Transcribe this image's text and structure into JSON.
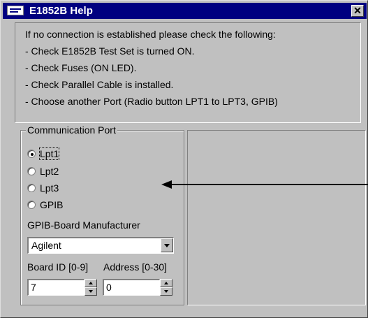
{
  "window": {
    "title": "E1852B Help",
    "icon": "app-window-icon",
    "close_glyph": "✕"
  },
  "info": {
    "lines": [
      "If no connection is established please check the following:",
      "- Check E1852B Test Set is turned ON.",
      "- Check Fuses (ON LED).",
      "- Check Parallel Cable is installed.",
      "- Choose another Port (Radio button LPT1 to LPT3, GPIB)"
    ]
  },
  "port_group": {
    "legend": "Communication Port",
    "options": [
      {
        "label": "Lpt1",
        "selected": true
      },
      {
        "label": "Lpt2",
        "selected": false
      },
      {
        "label": "Lpt3",
        "selected": false
      },
      {
        "label": "GPIB",
        "selected": false
      }
    ],
    "manufacturer_label": "GPIB-Board Manufacturer",
    "manufacturer_value": "Agilent",
    "board_id_label": "Board ID [0-9]",
    "board_id_value": "7",
    "address_label": "Address [0-30]",
    "address_value": "0"
  },
  "colors": {
    "title_bar": "#000080",
    "face": "#c0c0c0"
  }
}
